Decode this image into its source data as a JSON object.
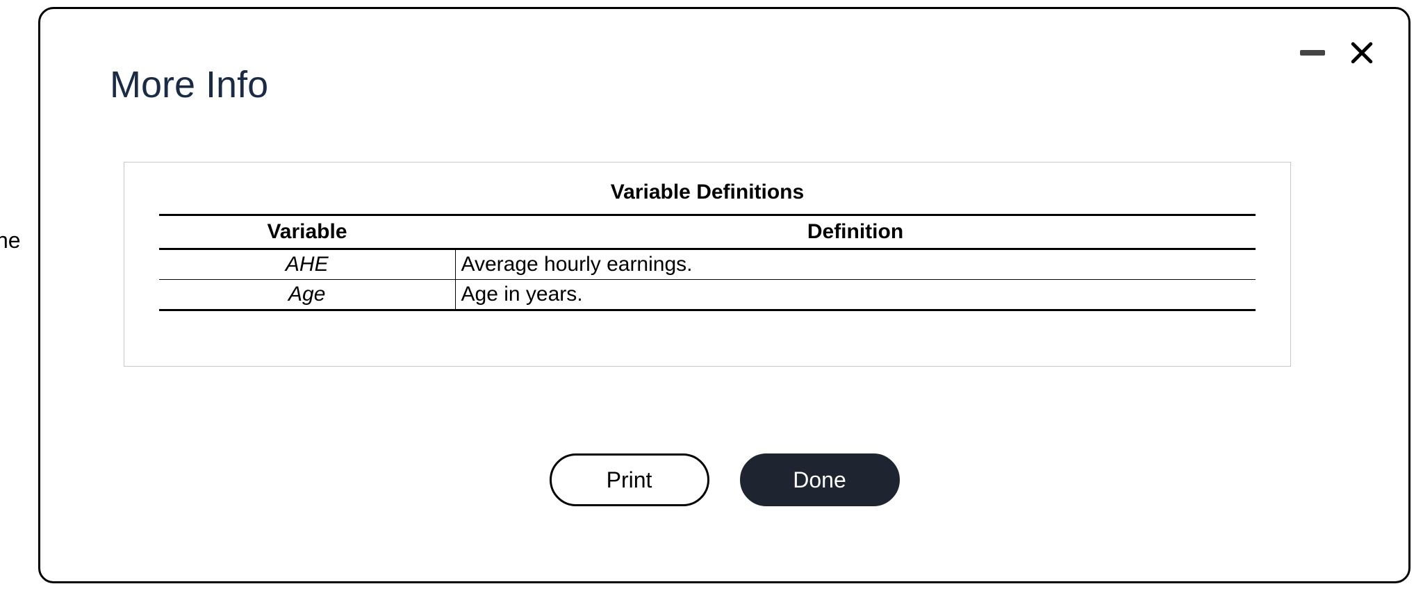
{
  "background_text": "he",
  "dialog": {
    "title": "More Info",
    "table": {
      "title": "Variable Definitions",
      "columns": {
        "variable": "Variable",
        "definition": "Definition"
      },
      "rows": [
        {
          "variable": "AHE",
          "definition": "Average hourly earnings."
        },
        {
          "variable": "Age",
          "definition": "Age in years."
        }
      ]
    },
    "buttons": {
      "print": "Print",
      "done": "Done"
    }
  }
}
